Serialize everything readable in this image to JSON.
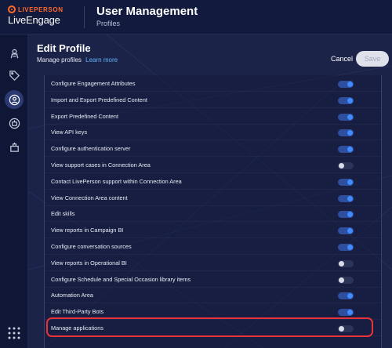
{
  "brand": {
    "company": "LIVEPERSON",
    "product": "LiveEngage",
    "accent_color": "#ff6a2c"
  },
  "header": {
    "title": "User Management",
    "subtitle": "Profiles"
  },
  "left_rail": {
    "items": [
      {
        "icon": "agent-icon",
        "active": false
      },
      {
        "icon": "tag-icon",
        "active": false
      },
      {
        "icon": "user-circle-icon",
        "active": true
      },
      {
        "icon": "bot-icon",
        "active": false
      },
      {
        "icon": "campaign-icon",
        "active": false
      }
    ],
    "apps_icon": "grid-icon"
  },
  "page": {
    "title": "Edit Profile",
    "manage_text": "Manage profiles",
    "learn_more": "Learn more",
    "cancel_label": "Cancel",
    "save_label": "Save"
  },
  "permissions": [
    {
      "label": "Configure Engagement Attributes",
      "enabled": true
    },
    {
      "label": "Import and Export Predefined Content",
      "enabled": true
    },
    {
      "label": "Export Predefined Content",
      "enabled": true
    },
    {
      "label": "View API keys",
      "enabled": true
    },
    {
      "label": "Configure authentication server",
      "enabled": true
    },
    {
      "label": "View support cases in Connection Area",
      "enabled": false
    },
    {
      "label": "Contact LivePerson support within Connection Area",
      "enabled": true
    },
    {
      "label": "View Connection Area content",
      "enabled": true
    },
    {
      "label": "Edit skills",
      "enabled": true
    },
    {
      "label": "View reports in Campaign BI",
      "enabled": true
    },
    {
      "label": "Configure conversation sources",
      "enabled": true
    },
    {
      "label": "View reports in Operational BI",
      "enabled": false
    },
    {
      "label": "Configure Schedule and Special Occasion library items",
      "enabled": false
    },
    {
      "label": "Automation Area",
      "enabled": true
    },
    {
      "label": "Edit Third-Party Bots",
      "enabled": true
    },
    {
      "label": "Manage applications",
      "enabled": false,
      "highlighted": true
    }
  ],
  "colors": {
    "toggle_on": "#3f8cff",
    "toggle_off": "#d9dce8",
    "highlight": "#e8333a",
    "link": "#5fb3ff"
  }
}
